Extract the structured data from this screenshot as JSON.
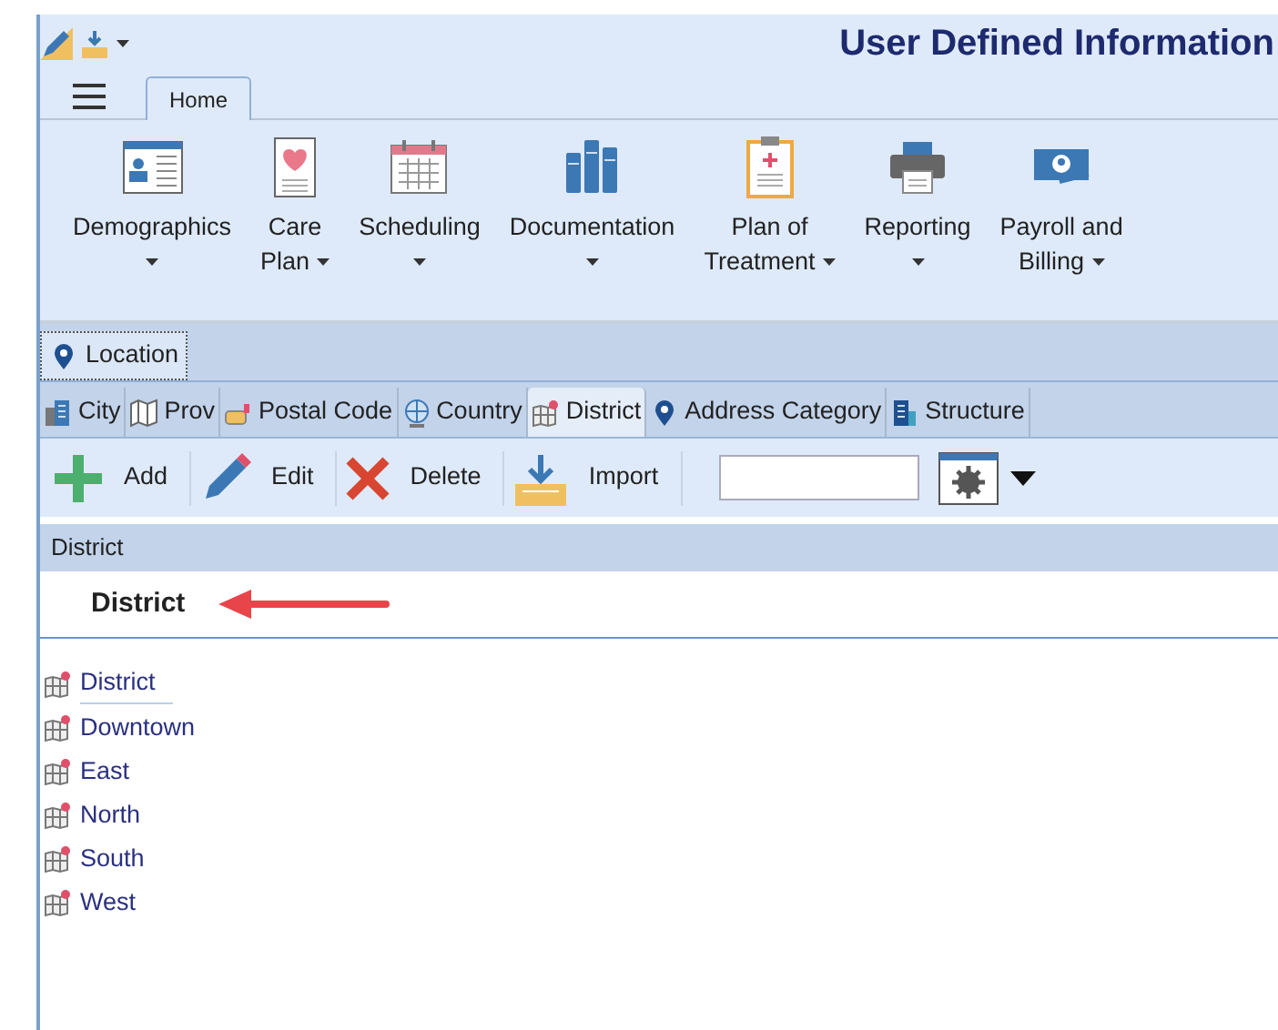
{
  "window": {
    "title": "User Defined Information"
  },
  "ribbon": {
    "menu_tab": {
      "label": "Home",
      "selected": true
    },
    "items": [
      {
        "kind": "demographics",
        "lines": [
          "Demographics"
        ]
      },
      {
        "kind": "care",
        "lines": [
          "Care",
          "Plan"
        ]
      },
      {
        "kind": "calendar",
        "lines": [
          "Scheduling"
        ]
      },
      {
        "kind": "books",
        "lines": [
          "Documentation"
        ]
      },
      {
        "kind": "clipboard",
        "lines": [
          "Plan of",
          "Treatment"
        ]
      },
      {
        "kind": "printer",
        "lines": [
          "Reporting"
        ]
      },
      {
        "kind": "money",
        "lines": [
          "Payroll and",
          "Billing"
        ]
      }
    ]
  },
  "document_tabs": [
    {
      "label": "Location",
      "selected": true
    }
  ],
  "sub_tabs": [
    {
      "kind": "building",
      "label": "City",
      "selected": false
    },
    {
      "kind": "map",
      "label": "Prov",
      "selected": false
    },
    {
      "kind": "mailbox",
      "label": "Postal Code",
      "selected": false
    },
    {
      "kind": "globe",
      "label": "Country",
      "selected": false
    },
    {
      "kind": "district",
      "label": "District",
      "selected": true
    },
    {
      "kind": "pin",
      "label": "Address Category",
      "selected": false
    },
    {
      "kind": "tower",
      "label": "Structure",
      "selected": false
    }
  ],
  "toolbar": [
    {
      "kind": "add",
      "label": "Add"
    },
    {
      "kind": "edit",
      "label": "Edit"
    },
    {
      "kind": "delete",
      "label": "Delete"
    },
    {
      "kind": "import",
      "label": "Import"
    }
  ],
  "grid": {
    "header": "District",
    "heading": "District",
    "rows": [
      {
        "label": "District",
        "selected": true
      },
      {
        "label": "Downtown",
        "selected": false
      },
      {
        "label": "East",
        "selected": false
      },
      {
        "label": "North",
        "selected": false
      },
      {
        "label": "South",
        "selected": false
      },
      {
        "label": "West",
        "selected": false
      }
    ]
  }
}
